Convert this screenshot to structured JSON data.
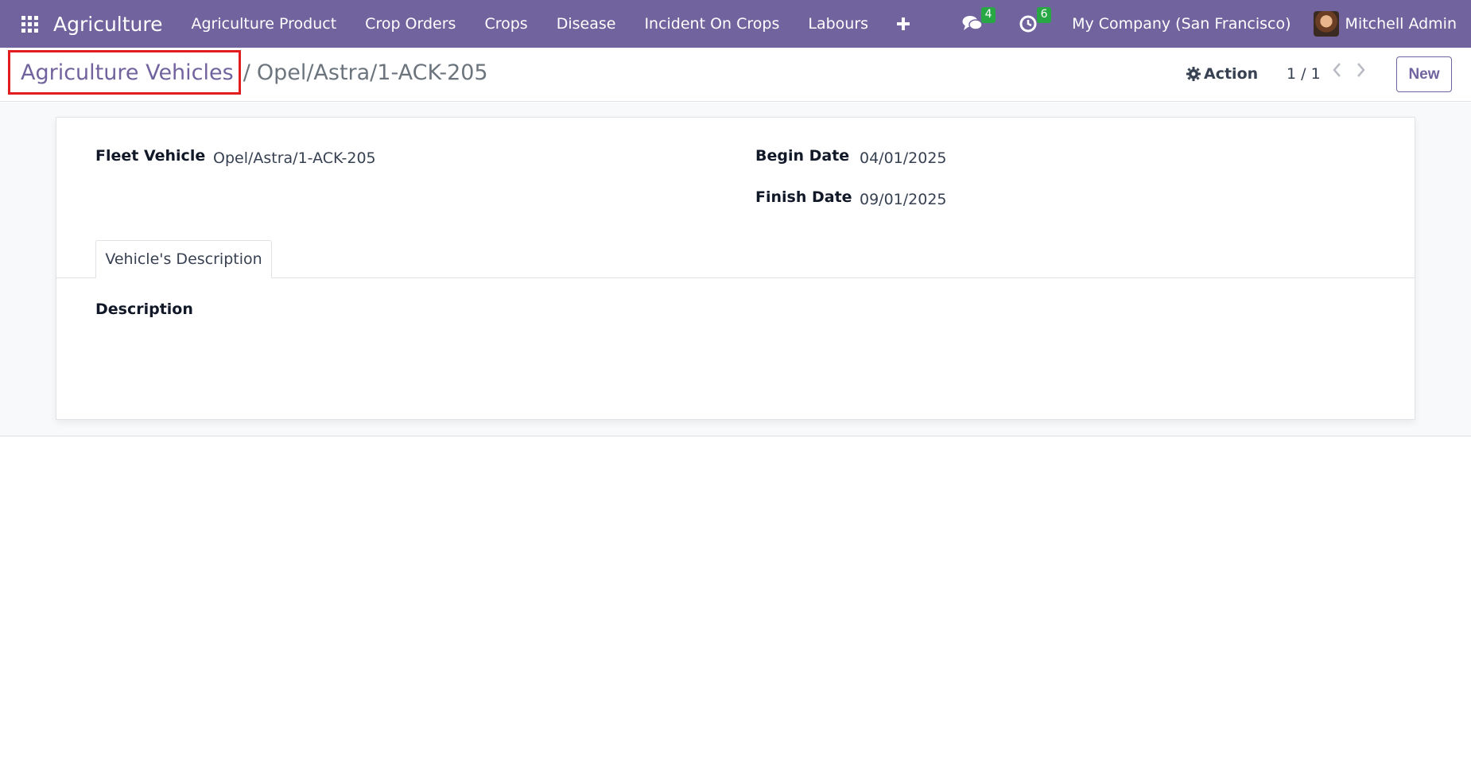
{
  "navbar": {
    "brand": "Agriculture",
    "menu": [
      "Agriculture Product",
      "Crop Orders",
      "Crops",
      "Disease",
      "Incident On Crops",
      "Labours"
    ],
    "plus_icon": "plus-icon",
    "messages_count": "4",
    "activities_count": "6",
    "company": "My Company (San Francisco)",
    "user": "Mitchell Admin",
    "accent_color": "#71639e"
  },
  "control_panel": {
    "breadcrumb_parent": "Agriculture Vehicles",
    "breadcrumb_separator": "/",
    "breadcrumb_current": "Opel/Astra/1-ACK-205",
    "action_label": "Action",
    "pager": "1 / 1",
    "new_label": "New"
  },
  "form": {
    "fleet_vehicle_label": "Fleet Vehicle",
    "fleet_vehicle_value": "Opel/Astra/1-ACK-205",
    "begin_date_label": "Begin Date",
    "begin_date_value": "04/01/2025",
    "finish_date_label": "Finish Date",
    "finish_date_value": "09/01/2025",
    "tab_label": "Vehicle's Description",
    "description_label": "Description"
  }
}
